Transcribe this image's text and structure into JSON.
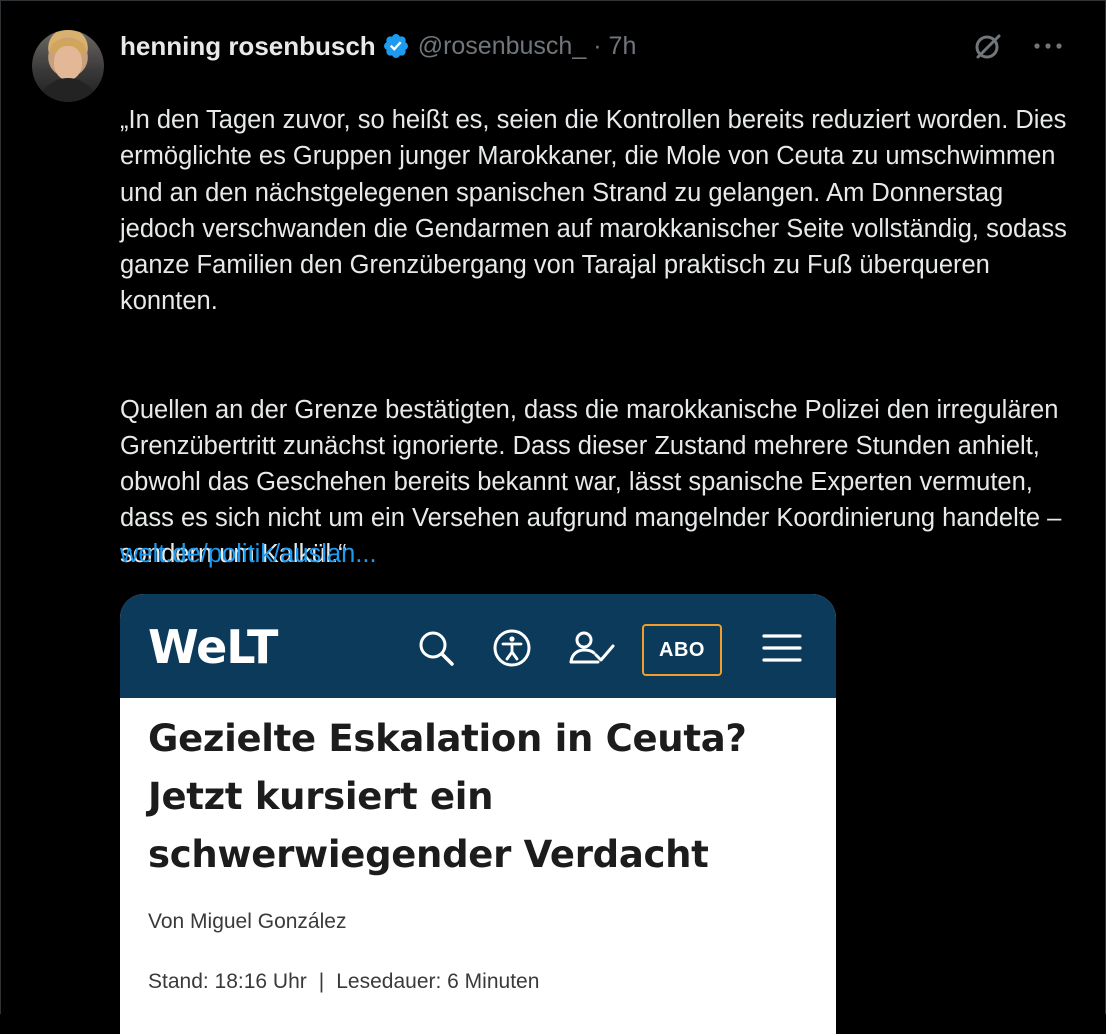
{
  "tweet": {
    "author": {
      "display_name": "henning rosenbusch",
      "handle": "@rosenbusch_",
      "verified": true,
      "avatar_icon": "avatar"
    },
    "separator": "·",
    "time": "7h",
    "actions": {
      "grok_icon": "slashed-circle-icon",
      "more_label": "···"
    },
    "text": {
      "paragraph1": "„In den Tagen zuvor, so heißt es, seien die Kontrollen bereits reduziert worden. Dies ermöglichte es Gruppen junger Marokkaner, die Mole von Ceuta zu umschwimmen und an den nächstgelegenen spanischen Strand zu gelangen. Am Donnerstag jedoch verschwanden die Gendarmen auf marokkanischer Seite vollständig, sodass ganze Familien den Grenzübergang von Tarajal praktisch zu Fuß überqueren konnten.",
      "paragraph2": "Quellen an der Grenze bestätigten, dass die marokkanische Polizei den irregulären Grenzübertritt zunächst ignorierte. Dass dieser Zustand mehrere Stunden anhielt, obwohl das Geschehen bereits bekannt war, lässt spanische Experten vermuten, dass es sich nicht um ein Versehen aufgrund mangelnder Koordinierung handelte – sondern um Kalkül.“"
    },
    "link": "welt.de/politik/auslan..."
  },
  "card": {
    "brand": "WeLT",
    "abo_label": "ABO",
    "headline": "Gezielte Eskalation in Ceuta? Jetzt kursiert ein schwerwiegender Verdacht",
    "author": "Von Miguel González",
    "stand": "Stand: 18:16 Uhr",
    "meta_separator": "|",
    "read_time": "Lesedauer: 6 Minuten"
  },
  "colors": {
    "background": "#000000",
    "text": "#e7e9ea",
    "muted": "#71767b",
    "link": "#1d9bf0",
    "verified": "#1d9bf0",
    "welt_bar": "#0c3a5b",
    "abo_border": "#f29c2b"
  }
}
